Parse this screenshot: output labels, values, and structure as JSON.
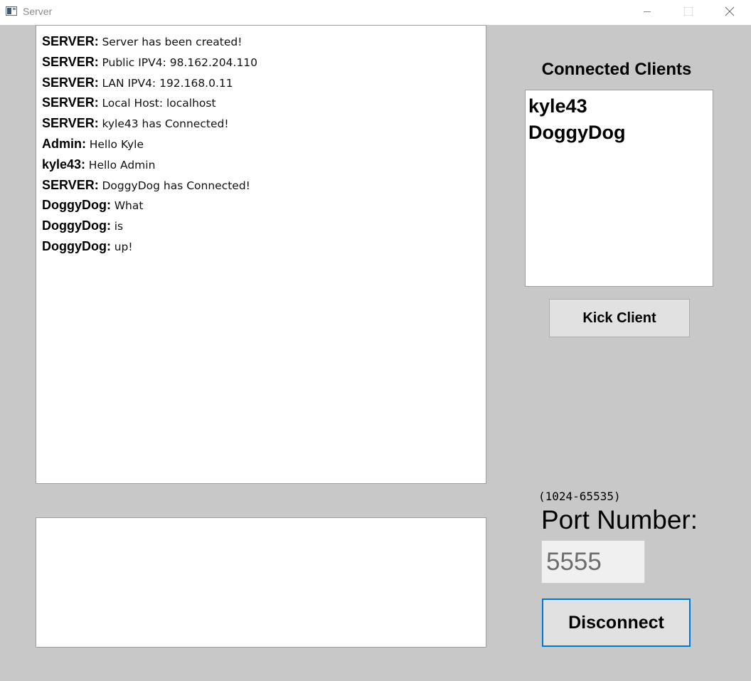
{
  "window": {
    "title": "Server",
    "icons": {
      "app": "app-window-icon",
      "minimize": "minimize-icon",
      "maximize": "maximize-icon",
      "close": "close-icon"
    }
  },
  "chat_log": [
    {
      "sender": "SERVER:",
      "message": "Server has been created!"
    },
    {
      "sender": "SERVER:",
      "message": "Public IPV4: 98.162.204.110"
    },
    {
      "sender": "SERVER:",
      "message": "LAN IPV4: 192.168.0.11"
    },
    {
      "sender": "SERVER:",
      "message": "Local Host: localhost"
    },
    {
      "sender": "SERVER:",
      "message": "kyle43 has Connected!"
    },
    {
      "sender": "Admin:",
      "message": "Hello Kyle"
    },
    {
      "sender": "kyle43:",
      "message": "Hello Admin"
    },
    {
      "sender": "SERVER:",
      "message": "DoggyDog has Connected!"
    },
    {
      "sender": "DoggyDog:",
      "message": "What"
    },
    {
      "sender": "DoggyDog:",
      "message": "is"
    },
    {
      "sender": "DoggyDog:",
      "message": "up!"
    }
  ],
  "message_input": {
    "value": ""
  },
  "clients": {
    "heading": "Connected Clients",
    "items": [
      "kyle43",
      "DoggyDog"
    ]
  },
  "kick_button": {
    "label": "Kick Client"
  },
  "port": {
    "range_hint": "(1024-65535)",
    "label": "Port Number:",
    "value": "5555"
  },
  "disconnect_button": {
    "label": "Disconnect"
  },
  "colors": {
    "background": "#c8c8c8",
    "focus_accent": "#0078d7"
  }
}
